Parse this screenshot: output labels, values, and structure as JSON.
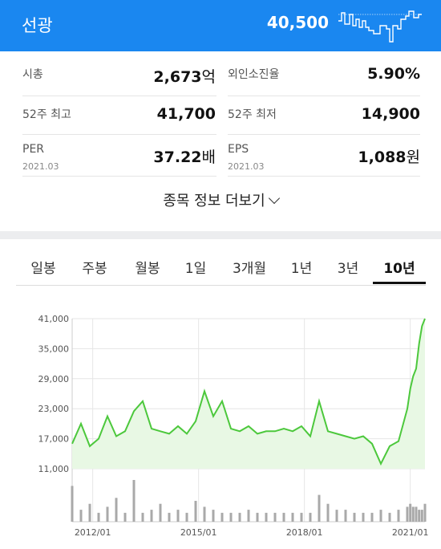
{
  "header": {
    "stock_name": "선광",
    "price": "40,500",
    "accent_color": "#1a87f0"
  },
  "info": {
    "market_cap": {
      "label": "시총",
      "value": "2,673",
      "unit": "억"
    },
    "foreign_ratio": {
      "label": "외인소진율",
      "value": "5.90%"
    },
    "high_52w": {
      "label": "52주 최고",
      "value": "41,700"
    },
    "low_52w": {
      "label": "52주 최저",
      "value": "14,900"
    },
    "per": {
      "label": "PER",
      "date": "2021.03",
      "value": "37.22",
      "unit": "배"
    },
    "eps": {
      "label": "EPS",
      "date": "2021.03",
      "value": "1,088",
      "unit": "원"
    }
  },
  "more_info": {
    "label": "종목 정보 더보기",
    "icon": "chevron-down-icon"
  },
  "tabs": [
    "일봉",
    "주봉",
    "월봉",
    "1일",
    "3개월",
    "1년",
    "3년",
    "10년"
  ],
  "active_tab": "10년",
  "chart_data": {
    "type": "area",
    "line_color": "#4cc83c",
    "fill_color": "#e8f8e4",
    "volume_color": "#a9a9a9",
    "grid": true,
    "y_ticks": [
      "41,000",
      "35,000",
      "29,000",
      "23,000",
      "17,000",
      "11,000"
    ],
    "ylim": [
      11000,
      41000
    ],
    "x_ticks": [
      "2012/01",
      "2015/01",
      "2018/01",
      "2021/01"
    ],
    "xlim": [
      "2011/06",
      "2021/06"
    ],
    "x": [
      "2011/06",
      "2011/09",
      "2011/12",
      "2012/03",
      "2012/06",
      "2012/09",
      "2012/12",
      "2013/03",
      "2013/06",
      "2013/09",
      "2013/12",
      "2014/03",
      "2014/06",
      "2014/09",
      "2014/12",
      "2015/03",
      "2015/06",
      "2015/09",
      "2015/12",
      "2016/03",
      "2016/06",
      "2016/09",
      "2016/12",
      "2017/03",
      "2017/06",
      "2017/09",
      "2017/12",
      "2018/03",
      "2018/06",
      "2018/09",
      "2018/12",
      "2019/03",
      "2019/06",
      "2019/09",
      "2019/12",
      "2020/03",
      "2020/06",
      "2020/09",
      "2020/12",
      "2021/01",
      "2021/02",
      "2021/03",
      "2021/04",
      "2021/05",
      "2021/06"
    ],
    "values": [
      16000,
      20000,
      15500,
      17000,
      21500,
      17500,
      18500,
      22500,
      24500,
      19000,
      18500,
      18000,
      19500,
      18000,
      20500,
      26500,
      21500,
      24500,
      19000,
      18500,
      19500,
      18000,
      18500,
      18500,
      19000,
      18500,
      19500,
      17500,
      24500,
      18500,
      18000,
      17500,
      17000,
      17500,
      16000,
      12000,
      15500,
      16500,
      23000,
      27000,
      29500,
      31000,
      36000,
      39500,
      41000
    ],
    "volume": [
      12,
      4,
      6,
      3,
      5,
      8,
      3,
      14,
      3,
      4,
      6,
      3,
      4,
      3,
      7,
      5,
      4,
      3,
      3,
      3,
      4,
      3,
      3,
      3,
      3,
      3,
      3,
      3,
      9,
      6,
      4,
      4,
      3,
      3,
      3,
      4,
      3,
      4,
      5,
      6,
      5,
      5,
      4,
      4,
      6
    ]
  }
}
